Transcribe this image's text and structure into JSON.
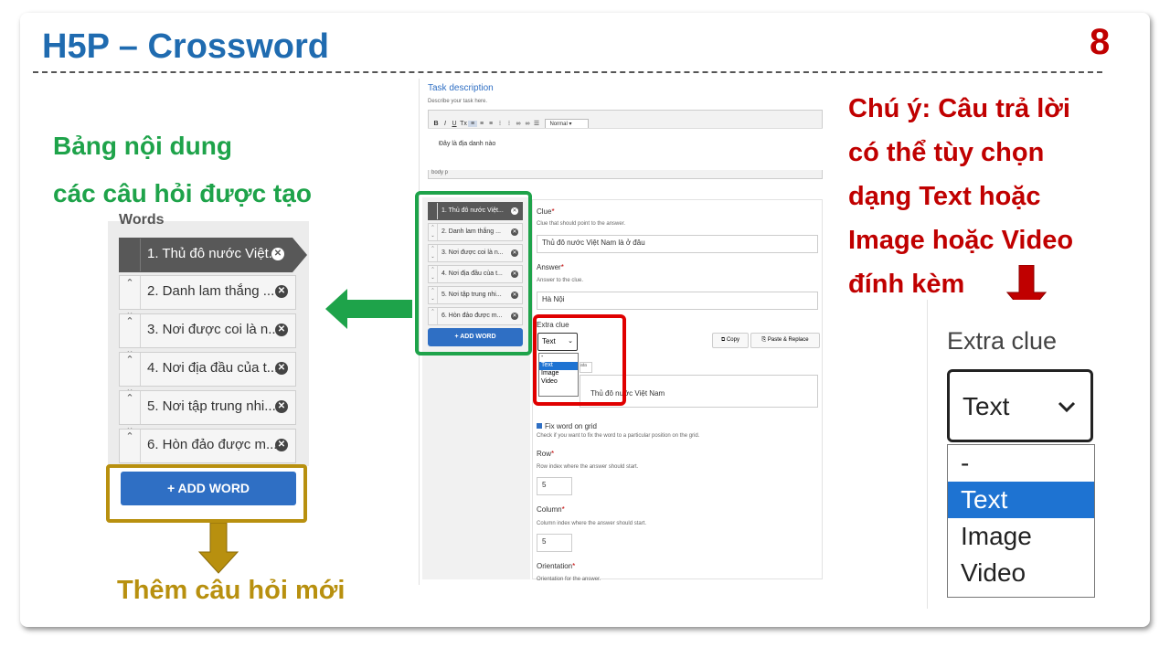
{
  "slide": {
    "title": "H5P – Crossword",
    "page_number": "8"
  },
  "notes": {
    "left_line1": "Bảng nội dung",
    "left_line2": "các câu hỏi được tạo",
    "right_lines": [
      "Chú ý: Câu trả lời",
      "có thể tùy chọn",
      "dạng Text hoặc",
      "Image hoặc Video",
      "đính kèm"
    ],
    "bottom": "Thêm câu hỏi mới"
  },
  "words_panel": {
    "heading": "Words",
    "items": [
      {
        "label": "1. Thủ đô nước Việt..."
      },
      {
        "label": "2. Danh lam thắng ..."
      },
      {
        "label": "3. Nơi được coi là n..."
      },
      {
        "label": "4. Nơi địa đầu của t..."
      },
      {
        "label": "5. Nơi tập trung nhi..."
      },
      {
        "label": "6. Hòn đảo được m..."
      }
    ],
    "add_word_label": "+ ADD WORD"
  },
  "editor": {
    "task_description_label": "Task description",
    "task_description_help": "Describe your task here.",
    "toolbar_format": "Normal",
    "task_text": "Đây là địa danh nào",
    "statusbar": "body  p",
    "small_words": [
      {
        "label": "1. Thủ đô nước Việt..."
      },
      {
        "label": "2. Danh lam thắng ..."
      },
      {
        "label": "3. Nơi được coi là n..."
      },
      {
        "label": "4. Nơi địa đầu của t..."
      },
      {
        "label": "5. Nơi tập trung nhi..."
      },
      {
        "label": "6. Hòn đảo được m..."
      }
    ],
    "small_add_word": "+ ADD WORD",
    "clue_label": "Clue",
    "clue_help": "Clue that should point to the answer.",
    "clue_value": "Thủ đô nước Việt Nam là ở đâu",
    "answer_label": "Answer",
    "answer_help": "Answer to the clue.",
    "answer_value": "Hà Nội",
    "extra_clue_label": "Extra clue",
    "extra_clue_selected": "Text",
    "extra_clue_options": [
      "-",
      "Text",
      "Image",
      "Video"
    ],
    "copy_label": "Copy",
    "paste_label": "Paste & Replace",
    "extra_text_value": "Thủ đô nước Việt Nam",
    "fix_word_label": "Fix word on grid",
    "fix_word_help": "Check if you want to fix the word to a particular position on the grid.",
    "row_label": "Row",
    "row_help": "Row index where the answer should start.",
    "row_value": "5",
    "column_label": "Column",
    "column_help": "Column index where the answer should start.",
    "column_value": "5",
    "orientation_label": "Orientation",
    "orientation_help": "Orientation for the answer."
  },
  "zoom_dropdown": {
    "label": "Extra clue",
    "selected": "Text",
    "options": [
      "-",
      "Text",
      "Image",
      "Video"
    ]
  },
  "colors": {
    "title": "#1f6bb0",
    "accent_red": "#c00000",
    "accent_green": "#1ea34a",
    "accent_gold": "#b8900f",
    "button_blue": "#2f6fc4",
    "selected_option": "#1e73d2"
  }
}
